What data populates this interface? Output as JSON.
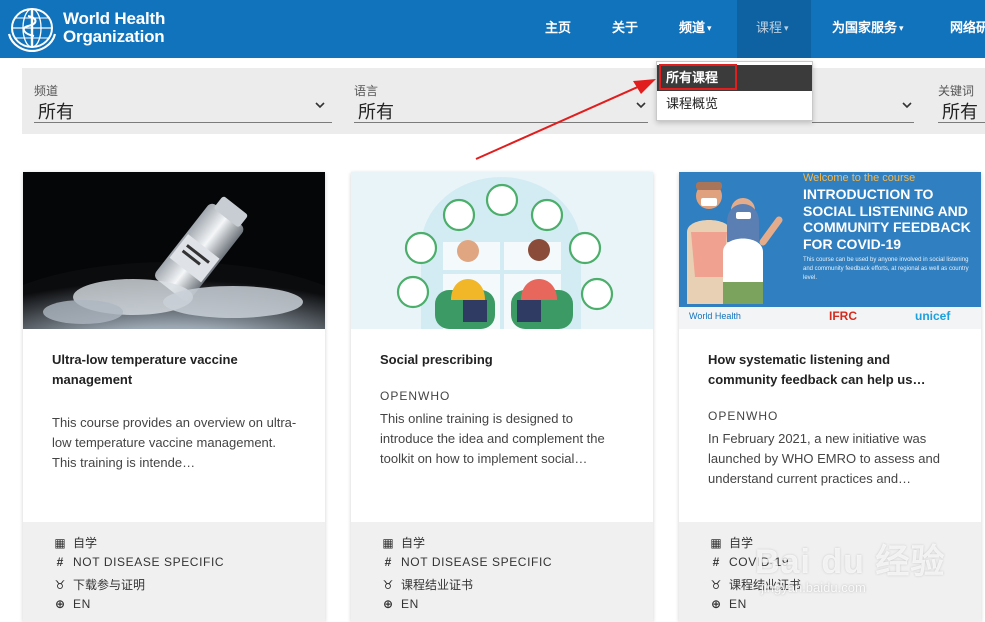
{
  "header": {
    "logo_line1": "World Health",
    "logo_line2": "Organization",
    "nav": [
      {
        "label": "主页",
        "has_caret": false
      },
      {
        "label": "关于",
        "has_caret": false
      },
      {
        "label": "频道",
        "has_caret": true
      },
      {
        "label": "课程",
        "has_caret": true,
        "active": true
      },
      {
        "label": "为国家服务",
        "has_caret": true
      },
      {
        "label": "网络研"
      }
    ],
    "caret_glyph": "▾"
  },
  "dropdown": {
    "items": [
      "所有课程",
      "课程概览"
    ],
    "selected_index": 0
  },
  "filters": {
    "channel": {
      "label": "频道",
      "value": "所有"
    },
    "language": {
      "label": "语言",
      "value": "所有"
    },
    "keyword": {
      "label": "关键词",
      "value": "所有"
    }
  },
  "courses": [
    {
      "title": "Ultra-low temperature vaccine management",
      "provider": "",
      "description": "This course provides an overview on ultra-low temperature vaccine management. This training is intende…",
      "meta": {
        "format": "自学",
        "topic": "NOT DISEASE SPECIFIC",
        "certificate": "下载参与证明",
        "language": "EN"
      }
    },
    {
      "title": "Social prescribing",
      "provider": "OPENWHO",
      "description": "This online training is designed to introduce the idea and complement the toolkit on how to implement social…",
      "meta": {
        "format": "自学",
        "topic": "NOT DISEASE SPECIFIC",
        "certificate": "课程结业证书",
        "language": "EN"
      }
    },
    {
      "title": "How systematic listening and community feedback can help us…",
      "provider": "OPENWHO",
      "description": "In February 2021, a new initiative was launched by WHO EMRO to assess and understand current practices and…",
      "meta": {
        "format": "自学",
        "topic": "COVID-19",
        "certificate": "课程结业证书",
        "language": "EN"
      },
      "banner": {
        "welcome": "Welcome to the course",
        "heading": "INTRODUCTION TO SOCIAL LISTENING AND COMMUNITY FEEDBACK FOR COVID-19",
        "body": "This course can be used by anyone involved in social listening and community feedback efforts, at regional as well as country level.",
        "partner1": "World Health",
        "partner2": "IFRC",
        "partner3": "unicef"
      }
    }
  ],
  "icons": {
    "format": "calendar-icon",
    "topic": "hash-icon",
    "certificate": "medal-icon",
    "language": "globe-icon"
  },
  "watermark": {
    "brand": "Bai du 经验",
    "url": "jingyan.baidu.com"
  },
  "colors": {
    "header": "#1273bd",
    "nav_active": "#0f62a1",
    "highlight": "#e11d1d",
    "footer_bg": "#f0f0f0"
  }
}
